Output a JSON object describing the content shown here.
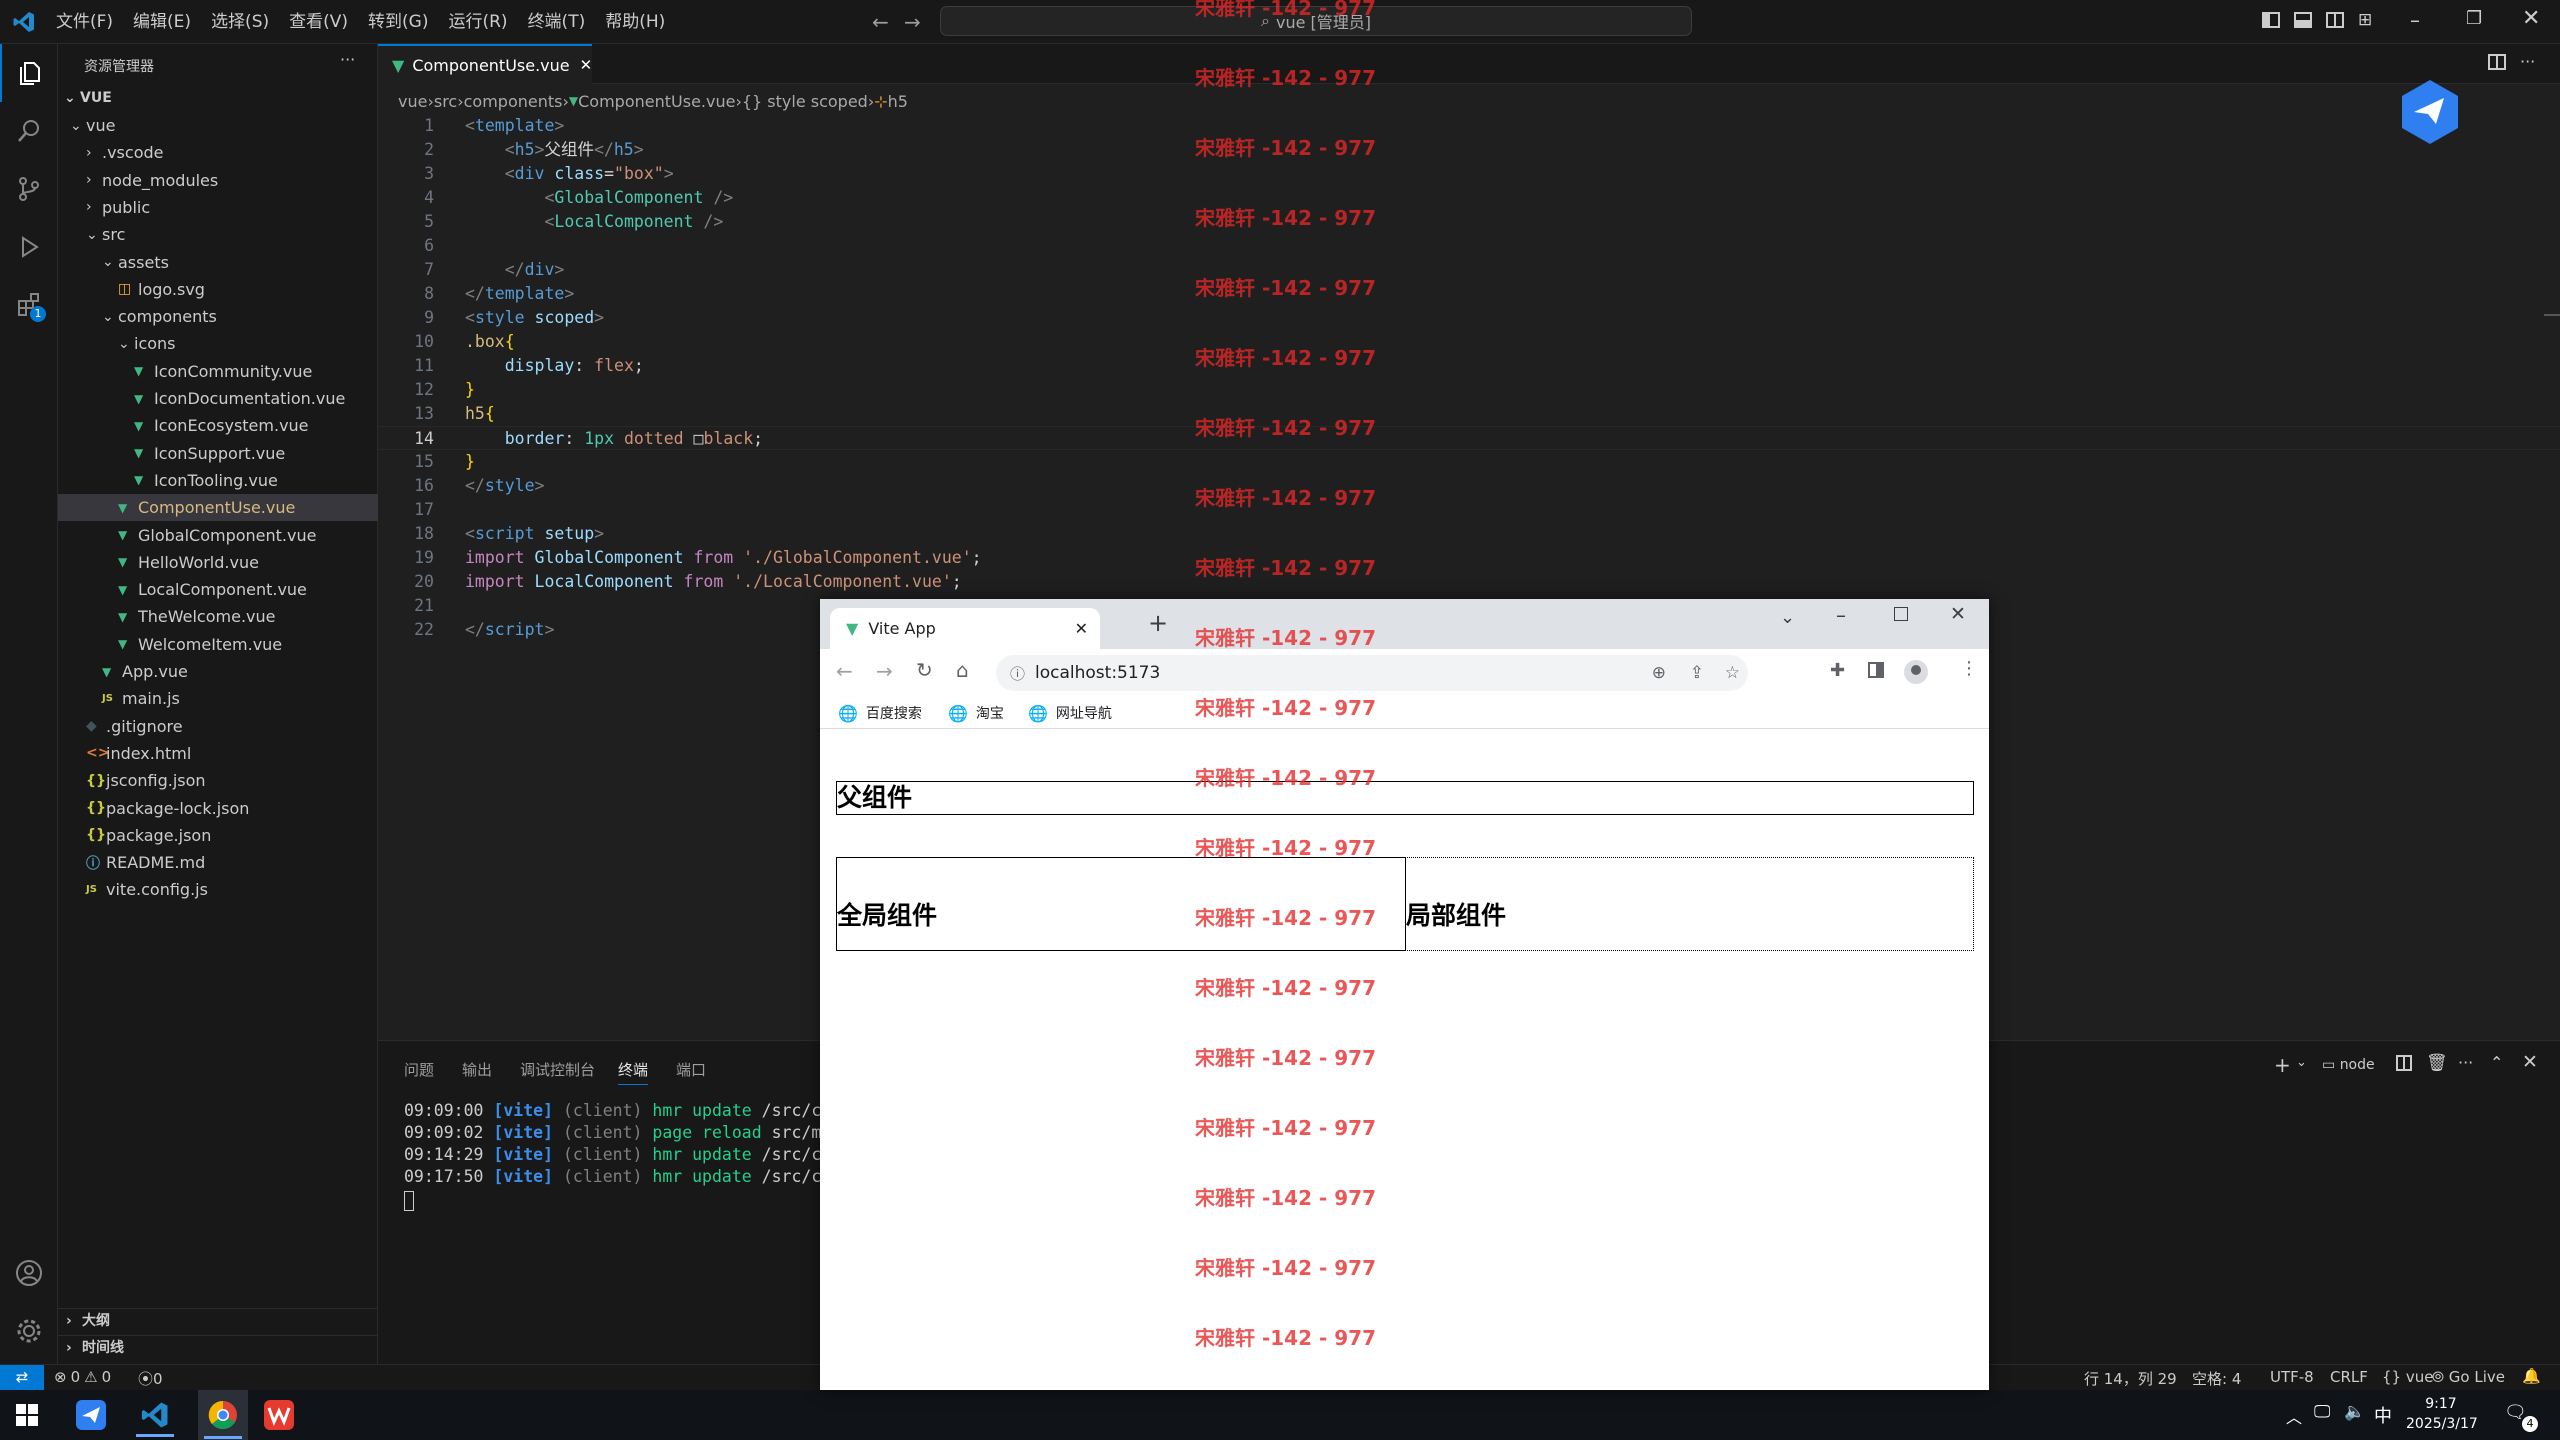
{
  "menu": [
    "文件(F)",
    "编辑(E)",
    "选择(S)",
    "查看(V)",
    "转到(G)",
    "运行(R)",
    "终端(T)",
    "帮助(H)"
  ],
  "command_center": "vue [管理员]",
  "sidebar": {
    "title": "资源管理器",
    "more": "···",
    "root": "VUE",
    "tree": [
      {
        "label": "vue",
        "depth": 0,
        "type": "folder-open"
      },
      {
        "label": ".vscode",
        "depth": 1,
        "type": "folder"
      },
      {
        "label": "node_modules",
        "depth": 1,
        "type": "folder"
      },
      {
        "label": "public",
        "depth": 1,
        "type": "folder"
      },
      {
        "label": "src",
        "depth": 1,
        "type": "folder-open"
      },
      {
        "label": "assets",
        "depth": 2,
        "type": "folder-open"
      },
      {
        "label": "logo.svg",
        "depth": 3,
        "type": "svg"
      },
      {
        "label": "components",
        "depth": 2,
        "type": "folder-open"
      },
      {
        "label": "icons",
        "depth": 3,
        "type": "folder-open"
      },
      {
        "label": "IconCommunity.vue",
        "depth": 4,
        "type": "vue"
      },
      {
        "label": "IconDocumentation.vue",
        "depth": 4,
        "type": "vue"
      },
      {
        "label": "IconEcosystem.vue",
        "depth": 4,
        "type": "vue"
      },
      {
        "label": "IconSupport.vue",
        "depth": 4,
        "type": "vue"
      },
      {
        "label": "IconTooling.vue",
        "depth": 4,
        "type": "vue"
      },
      {
        "label": "ComponentUse.vue",
        "depth": 3,
        "type": "vue",
        "selected": true
      },
      {
        "label": "GlobalComponent.vue",
        "depth": 3,
        "type": "vue"
      },
      {
        "label": "HelloWorld.vue",
        "depth": 3,
        "type": "vue"
      },
      {
        "label": "LocalComponent.vue",
        "depth": 3,
        "type": "vue"
      },
      {
        "label": "TheWelcome.vue",
        "depth": 3,
        "type": "vue"
      },
      {
        "label": "WelcomeItem.vue",
        "depth": 3,
        "type": "vue"
      },
      {
        "label": "App.vue",
        "depth": 2,
        "type": "vue"
      },
      {
        "label": "main.js",
        "depth": 2,
        "type": "js"
      },
      {
        "label": ".gitignore",
        "depth": 1,
        "type": "git"
      },
      {
        "label": "index.html",
        "depth": 1,
        "type": "html"
      },
      {
        "label": "jsconfig.json",
        "depth": 1,
        "type": "json"
      },
      {
        "label": "package-lock.json",
        "depth": 1,
        "type": "json"
      },
      {
        "label": "package.json",
        "depth": 1,
        "type": "json"
      },
      {
        "label": "README.md",
        "depth": 1,
        "type": "info"
      },
      {
        "label": "vite.config.js",
        "depth": 1,
        "type": "js"
      }
    ],
    "outline": "大纲",
    "timeline": "时间线",
    "extensions_badge": "1"
  },
  "editor": {
    "tab": "ComponentUse.vue",
    "tab_close": "✕",
    "breadcrumb": [
      "vue",
      "src",
      "components",
      "ComponentUse.vue",
      "{} style scoped",
      "h5"
    ],
    "current_line": 14
  },
  "panel": {
    "tabs": [
      "问题",
      "输出",
      "调试控制台",
      "终端",
      "端口"
    ],
    "active_tab": "终端",
    "terminal_name": "node",
    "terminal": [
      {
        "time": "09:09:00",
        "tag": "[vite]",
        "client": "(client)",
        "action": "hmr update",
        "path": "/src/compo"
      },
      {
        "time": "09:09:02",
        "tag": "[vite]",
        "client": "(client)",
        "action": "page reload",
        "path": "src/main."
      },
      {
        "time": "09:14:29",
        "tag": "[vite]",
        "client": "(client)",
        "action": "hmr update",
        "path": "/src/compo"
      },
      {
        "time": "09:17:50",
        "tag": "[vite]",
        "client": "(client)",
        "action": "hmr update",
        "path": "/src/compo"
      }
    ]
  },
  "status": {
    "errors": "0",
    "warnings": "0",
    "ports": "0",
    "position": "行 14，列 29",
    "spaces": "空格: 4",
    "encoding": "UTF-8",
    "eol": "CRLF",
    "language": "vue",
    "golive": "Go Live"
  },
  "browser": {
    "tab_title": "Vite App",
    "url": "localhost:5173",
    "bookmarks": [
      "百度搜索",
      "淘宝",
      "网址导航"
    ],
    "page": {
      "parent": "父组件",
      "global": "全局组件",
      "local": "局部组件"
    }
  },
  "watermark": "宋雅轩 -142 - 977",
  "taskbar": {
    "time": "9:17",
    "date": "2025/3/17",
    "ime": "中",
    "notifications": "4"
  }
}
